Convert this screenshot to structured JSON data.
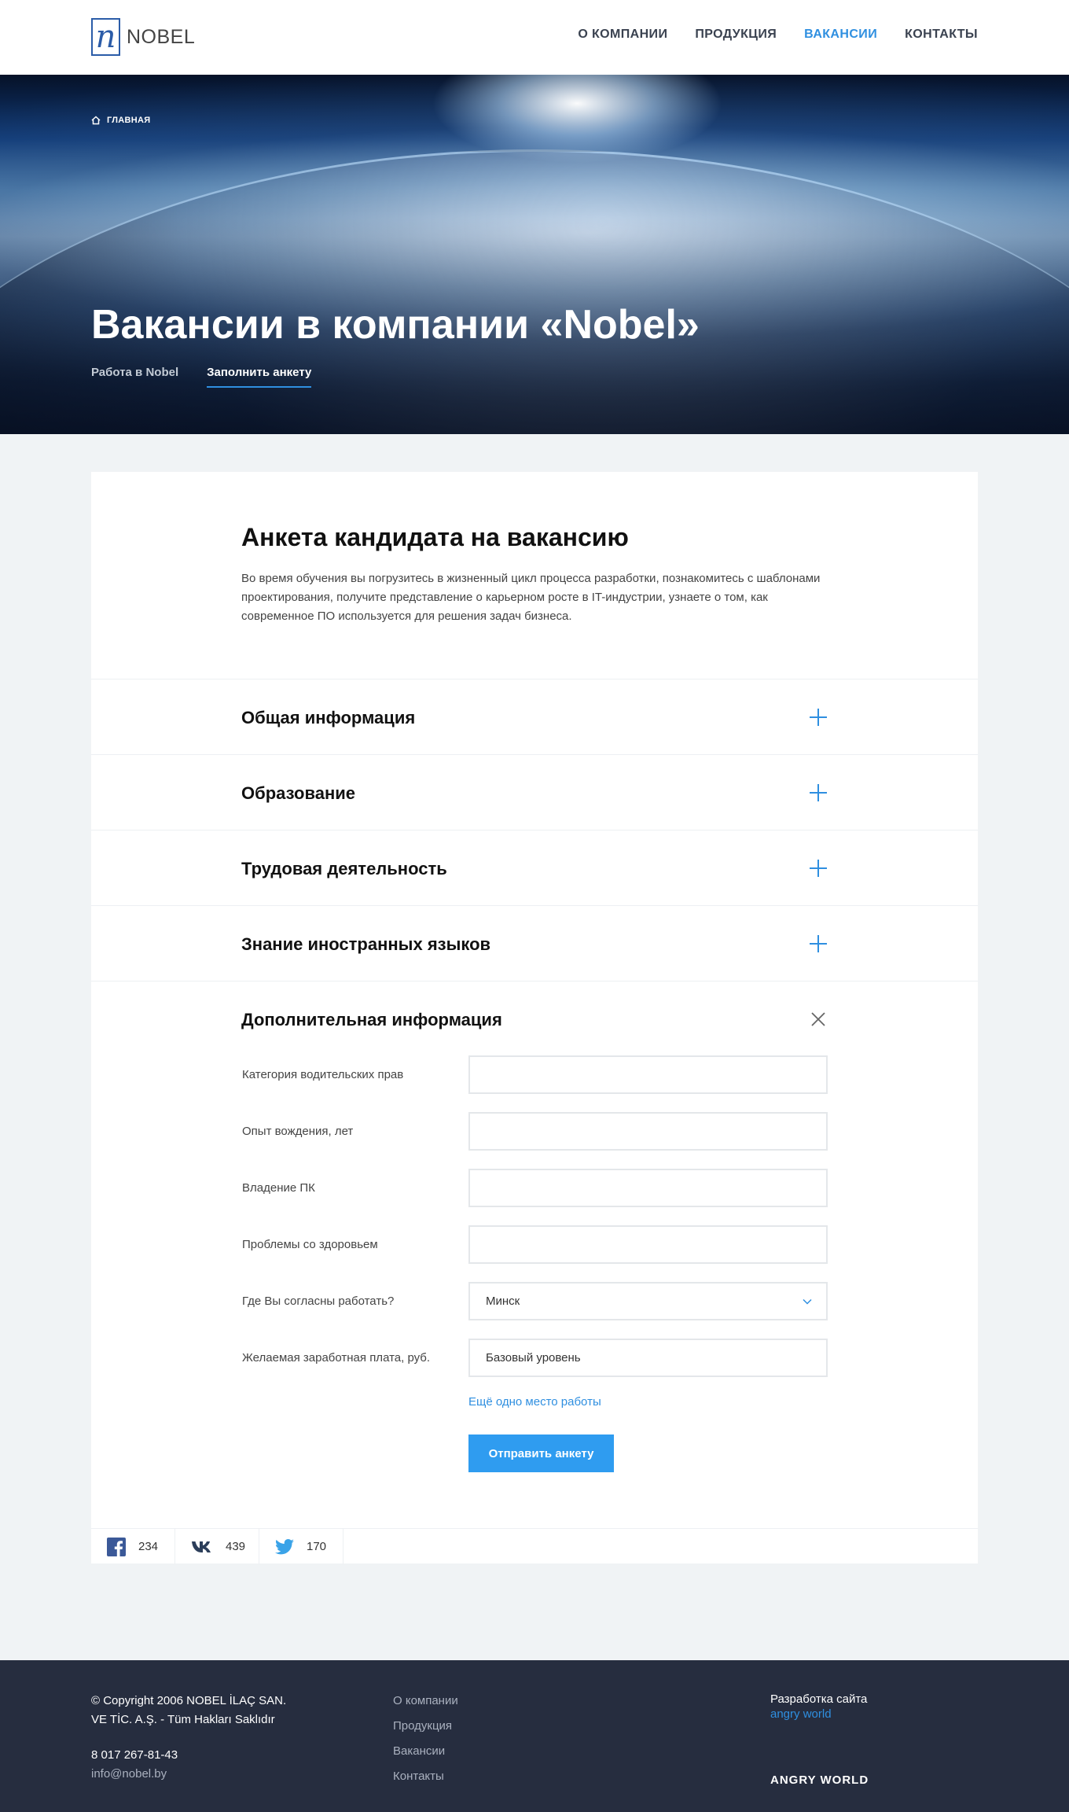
{
  "header": {
    "logo_text": "NOBEL",
    "nav": [
      "О КОМПАНИИ",
      "ПРОДУКЦИЯ",
      "ВАКАНСИИ",
      "КОНТАКТЫ"
    ],
    "active_nav": "ВАКАНСИИ"
  },
  "hero": {
    "breadcrumb": "ГЛАВНАЯ",
    "title": "Вакансии в компании «Nobel»",
    "tabs": [
      "Работа в Nobel",
      "Заполнить анкету"
    ],
    "active_tab": "Заполнить анкету"
  },
  "form": {
    "title": "Анкета кандидата на вакансию",
    "description": "Во время обучения вы погрузитесь в жизненный цикл процесса разработки, познакомитесь с шаблонами проектирования, получите представление о карьерном росте в IT-индустрии, узнаете о том, как современное ПО используется для решения задач бизнеса.",
    "sections": [
      {
        "title": "Общая информация",
        "state": "collapsed"
      },
      {
        "title": "Образование",
        "state": "collapsed"
      },
      {
        "title": "Трудовая деятельность",
        "state": "collapsed"
      },
      {
        "title": "Знание иностранных языков",
        "state": "collapsed"
      },
      {
        "title": "Дополнительная информация",
        "state": "expanded"
      }
    ],
    "fields": [
      {
        "label": "Категория водительских прав",
        "value": ""
      },
      {
        "label": "Опыт вождения, лет",
        "value": ""
      },
      {
        "label": "Владение ПК",
        "value": ""
      },
      {
        "label": "Проблемы со здоровьем",
        "value": ""
      },
      {
        "label": "Где Вы согласны работать?",
        "value": "Минск"
      },
      {
        "label": "Желаемая заработная плата, руб.",
        "value": "Базовый уровень"
      }
    ],
    "add_link": "Ещё одно место работы",
    "submit_label": "Отправить анкету"
  },
  "social": [
    {
      "icon": "facebook-icon",
      "count": "234"
    },
    {
      "icon": "vk-icon",
      "count": "439"
    },
    {
      "icon": "twitter-icon",
      "count": "170"
    }
  ],
  "footer": {
    "copyright_line1": "© Copyright 2006 NOBEL İLAÇ SAN.",
    "copyright_line2": "VE TİC. A.Ş. - Tüm Hakları Saklıdır",
    "phone": "8 017 267-81-43",
    "email": "info@nobel.by",
    "nav": [
      "О компании",
      "Продукция",
      "Вакансии",
      "Контакты"
    ],
    "dev_label": "Разработка сайта",
    "dev_link": "angry world",
    "dev_logo": "ANGRY WORLD"
  },
  "colors": {
    "accent": "#2f8fe0",
    "footer_bg": "#262d3f",
    "page_bg": "#f0f3f5"
  }
}
